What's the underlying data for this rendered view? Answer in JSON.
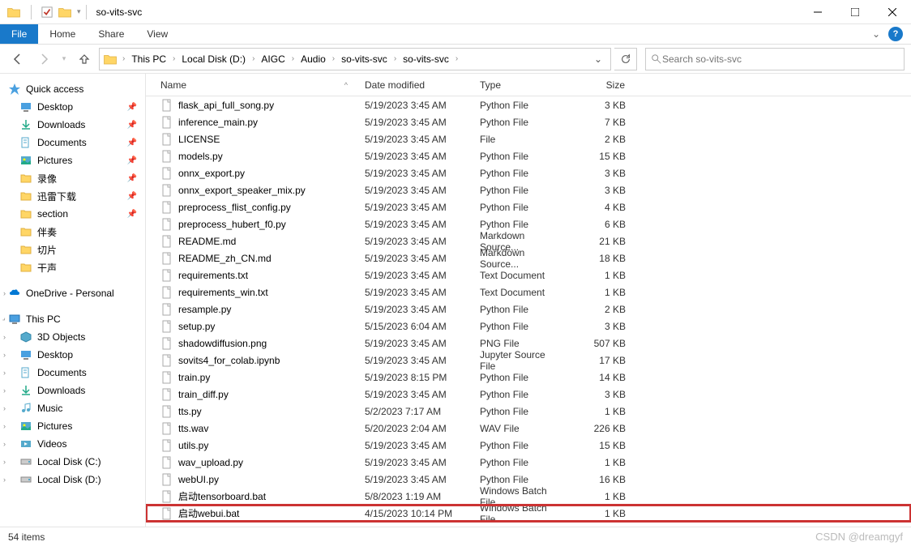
{
  "window": {
    "title": "so-vits-svc"
  },
  "menubar": {
    "file": "File",
    "tabs": [
      "Home",
      "Share",
      "View"
    ]
  },
  "addressbar": {
    "crumbs": [
      "This PC",
      "Local Disk (D:)",
      "AIGC",
      "Audio",
      "so-vits-svc",
      "so-vits-svc"
    ],
    "search_placeholder": "Search so-vits-svc"
  },
  "sidebar": {
    "quick_access": {
      "label": "Quick access",
      "items": [
        {
          "label": "Desktop",
          "icon": "desktop",
          "pinned": true
        },
        {
          "label": "Downloads",
          "icon": "downloads",
          "pinned": true
        },
        {
          "label": "Documents",
          "icon": "documents",
          "pinned": true
        },
        {
          "label": "Pictures",
          "icon": "pictures",
          "pinned": true
        },
        {
          "label": "录像",
          "icon": "folder",
          "pinned": true
        },
        {
          "label": "迅雷下载",
          "icon": "folder",
          "pinned": true
        },
        {
          "label": "section",
          "icon": "folder",
          "pinned": true
        },
        {
          "label": "伴奏",
          "icon": "folder",
          "pinned": false
        },
        {
          "label": "切片",
          "icon": "folder",
          "pinned": false
        },
        {
          "label": "干声",
          "icon": "folder",
          "pinned": false
        }
      ]
    },
    "onedrive": {
      "label": "OneDrive - Personal"
    },
    "this_pc": {
      "label": "This PC",
      "items": [
        {
          "label": "3D Objects",
          "icon": "3d"
        },
        {
          "label": "Desktop",
          "icon": "desktop"
        },
        {
          "label": "Documents",
          "icon": "documents"
        },
        {
          "label": "Downloads",
          "icon": "downloads"
        },
        {
          "label": "Music",
          "icon": "music"
        },
        {
          "label": "Pictures",
          "icon": "pictures"
        },
        {
          "label": "Videos",
          "icon": "videos"
        },
        {
          "label": "Local Disk (C:)",
          "icon": "disk"
        },
        {
          "label": "Local Disk (D:)",
          "icon": "disk"
        }
      ]
    }
  },
  "columns": {
    "name": "Name",
    "date": "Date modified",
    "type": "Type",
    "size": "Size"
  },
  "files": [
    {
      "name": "flask_api_full_song.py",
      "date": "5/19/2023 3:45 AM",
      "type": "Python File",
      "size": "3 KB",
      "icon": "py"
    },
    {
      "name": "inference_main.py",
      "date": "5/19/2023 3:45 AM",
      "type": "Python File",
      "size": "7 KB",
      "icon": "py"
    },
    {
      "name": "LICENSE",
      "date": "5/19/2023 3:45 AM",
      "type": "File",
      "size": "2 KB",
      "icon": "file"
    },
    {
      "name": "models.py",
      "date": "5/19/2023 3:45 AM",
      "type": "Python File",
      "size": "15 KB",
      "icon": "py"
    },
    {
      "name": "onnx_export.py",
      "date": "5/19/2023 3:45 AM",
      "type": "Python File",
      "size": "3 KB",
      "icon": "py"
    },
    {
      "name": "onnx_export_speaker_mix.py",
      "date": "5/19/2023 3:45 AM",
      "type": "Python File",
      "size": "3 KB",
      "icon": "py"
    },
    {
      "name": "preprocess_flist_config.py",
      "date": "5/19/2023 3:45 AM",
      "type": "Python File",
      "size": "4 KB",
      "icon": "py"
    },
    {
      "name": "preprocess_hubert_f0.py",
      "date": "5/19/2023 3:45 AM",
      "type": "Python File",
      "size": "6 KB",
      "icon": "py"
    },
    {
      "name": "README.md",
      "date": "5/19/2023 3:45 AM",
      "type": "Markdown Source...",
      "size": "21 KB",
      "icon": "md"
    },
    {
      "name": "README_zh_CN.md",
      "date": "5/19/2023 3:45 AM",
      "type": "Markdown Source...",
      "size": "18 KB",
      "icon": "md"
    },
    {
      "name": "requirements.txt",
      "date": "5/19/2023 3:45 AM",
      "type": "Text Document",
      "size": "1 KB",
      "icon": "txt"
    },
    {
      "name": "requirements_win.txt",
      "date": "5/19/2023 3:45 AM",
      "type": "Text Document",
      "size": "1 KB",
      "icon": "txt"
    },
    {
      "name": "resample.py",
      "date": "5/19/2023 3:45 AM",
      "type": "Python File",
      "size": "2 KB",
      "icon": "py"
    },
    {
      "name": "setup.py",
      "date": "5/15/2023 6:04 AM",
      "type": "Python File",
      "size": "3 KB",
      "icon": "py"
    },
    {
      "name": "shadowdiffusion.png",
      "date": "5/19/2023 3:45 AM",
      "type": "PNG File",
      "size": "507 KB",
      "icon": "png"
    },
    {
      "name": "sovits4_for_colab.ipynb",
      "date": "5/19/2023 3:45 AM",
      "type": "Jupyter Source File",
      "size": "17 KB",
      "icon": "ipynb"
    },
    {
      "name": "train.py",
      "date": "5/19/2023 8:15 PM",
      "type": "Python File",
      "size": "14 KB",
      "icon": "py"
    },
    {
      "name": "train_diff.py",
      "date": "5/19/2023 3:45 AM",
      "type": "Python File",
      "size": "3 KB",
      "icon": "py"
    },
    {
      "name": "tts.py",
      "date": "5/2/2023 7:17 AM",
      "type": "Python File",
      "size": "1 KB",
      "icon": "py"
    },
    {
      "name": "tts.wav",
      "date": "5/20/2023 2:04 AM",
      "type": "WAV File",
      "size": "226 KB",
      "icon": "wav"
    },
    {
      "name": "utils.py",
      "date": "5/19/2023 3:45 AM",
      "type": "Python File",
      "size": "15 KB",
      "icon": "py"
    },
    {
      "name": "wav_upload.py",
      "date": "5/19/2023 3:45 AM",
      "type": "Python File",
      "size": "1 KB",
      "icon": "py"
    },
    {
      "name": "webUI.py",
      "date": "5/19/2023 3:45 AM",
      "type": "Python File",
      "size": "16 KB",
      "icon": "py"
    },
    {
      "name": "启动tensorboard.bat",
      "date": "5/8/2023 1:19 AM",
      "type": "Windows Batch File",
      "size": "1 KB",
      "icon": "bat"
    },
    {
      "name": "启动webui.bat",
      "date": "4/15/2023 10:14 PM",
      "type": "Windows Batch File",
      "size": "1 KB",
      "icon": "bat",
      "highlighted": true
    }
  ],
  "statusbar": {
    "count": "54 items",
    "watermark": "CSDN @dreamgyf"
  }
}
